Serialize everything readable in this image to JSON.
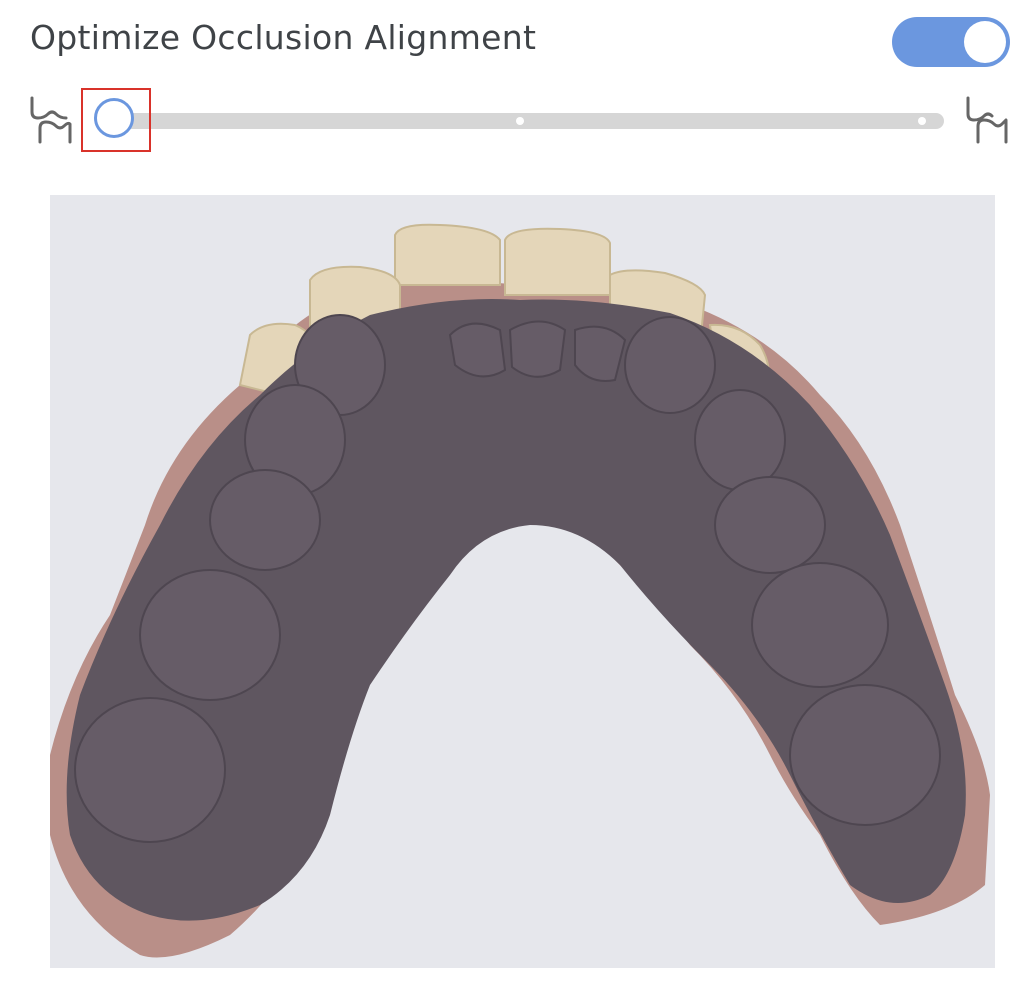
{
  "panel": {
    "title": "Optimize Occlusion Alignment",
    "toggle_on": true,
    "accent_color": "#6b97df",
    "highlight_color": "#d9322a"
  },
  "slider": {
    "value_fraction": 0.0,
    "tick_positions": [
      0.5,
      1.0
    ],
    "left_icon": "upper-jaw-icon",
    "right_icon": "lower-jaw-icon"
  },
  "viewer": {
    "content": "3D dental scan, occlusal view of mandibular arch",
    "background_color": "#e6e7ec"
  }
}
